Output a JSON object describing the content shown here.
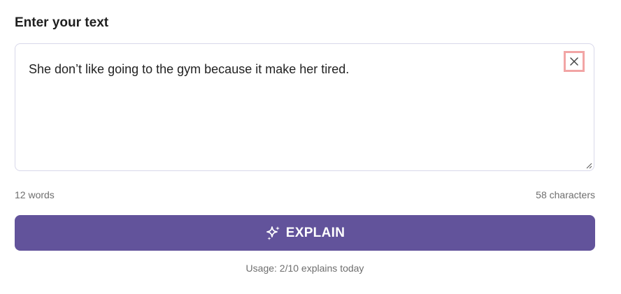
{
  "form": {
    "heading": "Enter your text",
    "textarea_value": "She don’t like going to the gym because it make her tired.",
    "clear_icon": "close-icon"
  },
  "counts": {
    "words": "12 words",
    "characters": "58 characters"
  },
  "explain_button": {
    "label": "EXPLAIN",
    "icon": "sparkles-icon",
    "color": "#62539b"
  },
  "usage": "Usage: 2/10 explains today"
}
